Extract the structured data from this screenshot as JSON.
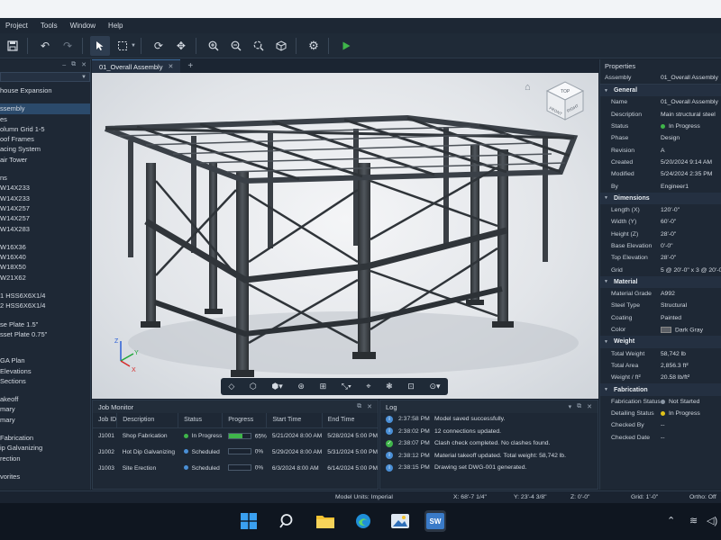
{
  "menu": [
    "Project",
    "Tools",
    "Window",
    "Help"
  ],
  "toolbar_icons": [
    "save-icon",
    "undo-icon",
    "redo-icon",
    "select-pointer-icon",
    "box-select-icon",
    "rotate-icon",
    "move-icon",
    "zoom-in-icon",
    "zoom-out-icon",
    "zoom-fit-icon",
    "cube-icon",
    "settings-gear-icon",
    "run-play-icon"
  ],
  "tree": {
    "items": [
      "house Expansion",
      "",
      "ssembly",
      "es",
      "olumn Grid 1-5",
      "oof Frames",
      "acing System",
      "air Tower",
      "",
      "ns",
      "W14X233",
      "W14X233",
      "W14X257",
      "W14X257",
      "W14X283",
      "",
      "W16X36",
      "W16X40",
      "W18X50",
      "W21X62",
      "",
      "1   HSS6X6X1/4",
      "2   HSS6X6X1/4",
      "",
      "se Plate 1.5\"",
      "sset Plate 0.75\"",
      "",
      "",
      "  GA Plan",
      "  Elevations",
      "  Sections",
      "",
      "akeoff",
      "mary",
      "mary",
      "",
      "Fabrication",
      "ip Galvanizing",
      "rection",
      "",
      "vorites"
    ]
  },
  "tab": {
    "label": "01_Overall Assembly",
    "add": "+"
  },
  "job_monitor": {
    "title": "Job Monitor",
    "headers": [
      "Job ID",
      "Description",
      "Status",
      "Progress",
      "Start Time",
      "End Time"
    ],
    "rows": [
      {
        "id": "J1001",
        "desc": "Shop Fabrication",
        "status": "In Progress",
        "status_color": "#3fb54a",
        "progress": 65,
        "progress_label": "65%",
        "start": "5/21/2024 8:00 AM",
        "end": "5/28/2024 5:00 PM"
      },
      {
        "id": "J1002",
        "desc": "Hot Dip Galvanizing",
        "status": "Scheduled",
        "status_color": "#4a8fd6",
        "progress": 0,
        "progress_label": "0%",
        "start": "5/29/2024 8:00 AM",
        "end": "5/31/2024 5:00 PM"
      },
      {
        "id": "J1003",
        "desc": "Site Erection",
        "status": "Scheduled",
        "status_color": "#4a8fd6",
        "progress": 0,
        "progress_label": "0%",
        "start": "6/3/2024 8:00 AM",
        "end": "6/14/2024 5:00 PM"
      }
    ]
  },
  "log": {
    "title": "Log",
    "rows": [
      {
        "time": "2:37:58 PM",
        "msg": "Model saved successfully.",
        "icon": "info-icon",
        "color": "#4a8fd6"
      },
      {
        "time": "2:38:02 PM",
        "msg": "12 connections updated.",
        "icon": "info-icon",
        "color": "#4a8fd6"
      },
      {
        "time": "2:38:07 PM",
        "msg": "Clash check completed. No clashes found.",
        "icon": "check-icon",
        "color": "#3fb54a"
      },
      {
        "time": "2:38:12 PM",
        "msg": "Material takeoff updated. Total weight: 58,742 lb.",
        "icon": "info-icon",
        "color": "#4a8fd6"
      },
      {
        "time": "2:38:15 PM",
        "msg": "Drawing set DWG-001 generated.",
        "icon": "info-icon",
        "color": "#4a8fd6"
      }
    ]
  },
  "properties": {
    "title": "Properties",
    "assembly_key": "Assembly",
    "assembly_val": "01_Overall Assembly",
    "sections": [
      {
        "name": "General",
        "rows": [
          {
            "k": "Name",
            "v": "01_Overall Assembly"
          },
          {
            "k": "Description",
            "v": "Main structural steel"
          },
          {
            "k": "Status",
            "v": "In Progress",
            "dot": "#3fb54a"
          },
          {
            "k": "Phase",
            "v": "Design"
          },
          {
            "k": "Revision",
            "v": "A"
          },
          {
            "k": "Created",
            "v": "5/20/2024 9:14 AM"
          },
          {
            "k": "Modified",
            "v": "5/24/2024 2:35 PM"
          },
          {
            "k": "By",
            "v": "Engineer1"
          }
        ]
      },
      {
        "name": "Dimensions",
        "rows": [
          {
            "k": "Length (X)",
            "v": "120'-0\""
          },
          {
            "k": "Width (Y)",
            "v": "60'-0\""
          },
          {
            "k": "Height (Z)",
            "v": "28'-0\""
          },
          {
            "k": "Base Elevation",
            "v": "0'-0\""
          },
          {
            "k": "Top Elevation",
            "v": "28'-0\""
          },
          {
            "k": "Grid",
            "v": "5 @ 20'-0\" x 3 @ 20'-0\""
          }
        ]
      },
      {
        "name": "Material",
        "rows": [
          {
            "k": "Material Grade",
            "v": "A992"
          },
          {
            "k": "Steel Type",
            "v": "Structural"
          },
          {
            "k": "Coating",
            "v": "Painted"
          },
          {
            "k": "Color",
            "v": "Dark Gray",
            "swatch": "#5c6066"
          }
        ]
      },
      {
        "name": "Weight",
        "rows": [
          {
            "k": "Total Weight",
            "v": "58,742 lb"
          },
          {
            "k": "Total Area",
            "v": "2,856.3 ft²"
          },
          {
            "k": "Weight / ft²",
            "v": "20.58 lb/ft²"
          }
        ]
      },
      {
        "name": "Fabrication",
        "rows": [
          {
            "k": "Fabrication Status",
            "v": "Not Started",
            "dot": "#8a96a4"
          },
          {
            "k": "Detailing Status",
            "v": "In Progress",
            "dot": "#e0c21a"
          },
          {
            "k": "Checked By",
            "v": "--"
          },
          {
            "k": "Checked Date",
            "v": "--"
          }
        ]
      }
    ]
  },
  "status": {
    "units": "Model Units: Imperial",
    "x": "X:  68'-7 1/4\"",
    "y": "Y:  23'-4 3/8\"",
    "z": "Z:  0'-0\"",
    "grid": "Grid:  1'-0\"",
    "ortho": "Ortho:  Off"
  },
  "viewcube": {
    "top": "TOP",
    "front": "FRONT",
    "right": "RIGHT"
  },
  "axes": {
    "x": "X",
    "y": "Y",
    "z": "Z"
  },
  "taskbar": {
    "app_label": "SW"
  }
}
